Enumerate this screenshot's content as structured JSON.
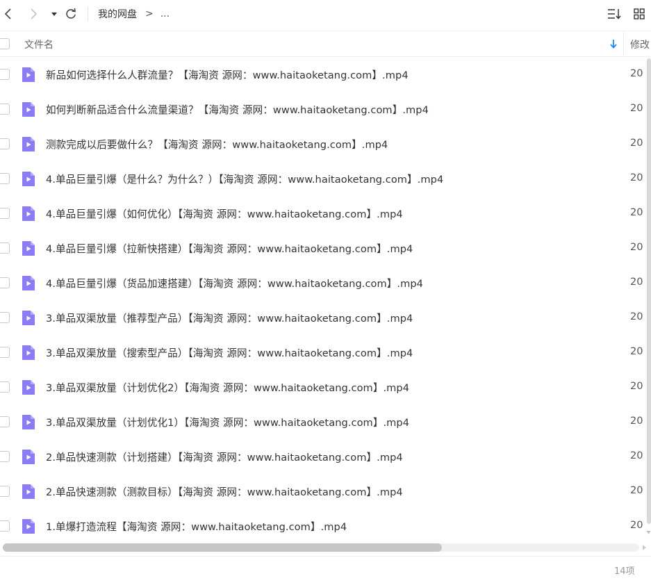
{
  "toolbar": {
    "back_icon": "chevron-left-icon",
    "forward_icon": "chevron-right-icon",
    "history_icon": "caret-down-icon",
    "refresh_icon": "refresh-icon",
    "sort_icon": "sort-list-icon",
    "view_icon": "grid-view-icon"
  },
  "breadcrumb": {
    "root": "我的网盘",
    "separator": ">",
    "more": "..."
  },
  "header": {
    "name_col": "文件名",
    "sort_icon": "arrow-down-icon",
    "modified_col": "修改"
  },
  "files": [
    {
      "name": "新品如何选择什么人群流量？【海淘资 源网：www.haitaoketang.com】.mp4",
      "modified": "20",
      "icon": "video-file-icon"
    },
    {
      "name": "如何判断新品适合什么流量渠道？【海淘资 源网：www.haitaoketang.com】.mp4",
      "modified": "20",
      "icon": "video-file-icon"
    },
    {
      "name": "测款完成以后要做什么？【海淘资 源网：www.haitaoketang.com】.mp4",
      "modified": "20",
      "icon": "video-file-icon"
    },
    {
      "name": "4.单品巨量引爆（是什么？为什么？）【海淘资 源网：www.haitaoketang.com】.mp4",
      "modified": "20",
      "icon": "video-file-icon"
    },
    {
      "name": "4.单品巨量引爆（如何优化）【海淘资 源网：www.haitaoketang.com】.mp4",
      "modified": "20",
      "icon": "video-file-icon"
    },
    {
      "name": "4.单品巨量引爆（拉新快搭建）【海淘资 源网：www.haitaoketang.com】.mp4",
      "modified": "20",
      "icon": "video-file-icon"
    },
    {
      "name": "4.单品巨量引爆（货品加速搭建）【海淘资 源网：www.haitaoketang.com】.mp4",
      "modified": "20",
      "icon": "video-file-icon"
    },
    {
      "name": "3.单品双渠放量（推荐型产品）【海淘资 源网：www.haitaoketang.com】.mp4",
      "modified": "20",
      "icon": "video-file-icon"
    },
    {
      "name": "3.单品双渠放量（搜索型产品）【海淘资 源网：www.haitaoketang.com】.mp4",
      "modified": "20",
      "icon": "video-file-icon"
    },
    {
      "name": "3.单品双渠放量（计划优化2）【海淘资 源网：www.haitaoketang.com】.mp4",
      "modified": "20",
      "icon": "video-file-icon"
    },
    {
      "name": "3.单品双渠放量（计划优化1）【海淘资 源网：www.haitaoketang.com】.mp4",
      "modified": "20",
      "icon": "video-file-icon"
    },
    {
      "name": "2.单品快速测款（计划搭建）【海淘资 源网：www.haitaoketang.com】.mp4",
      "modified": "20",
      "icon": "video-file-icon"
    },
    {
      "name": "2.单品快速测款（测款目标）【海淘资 源网：www.haitaoketang.com】.mp4",
      "modified": "20",
      "icon": "video-file-icon"
    },
    {
      "name": "1.单爆打造流程【海淘资 源网：www.haitaoketang.com】.mp4",
      "modified": "20",
      "icon": "video-file-icon"
    }
  ],
  "footer": {
    "item_count": "14项"
  },
  "colors": {
    "file_icon": "#8b7cf6",
    "accent": "#1a8cff",
    "text": "#333333",
    "muted": "#999999"
  }
}
